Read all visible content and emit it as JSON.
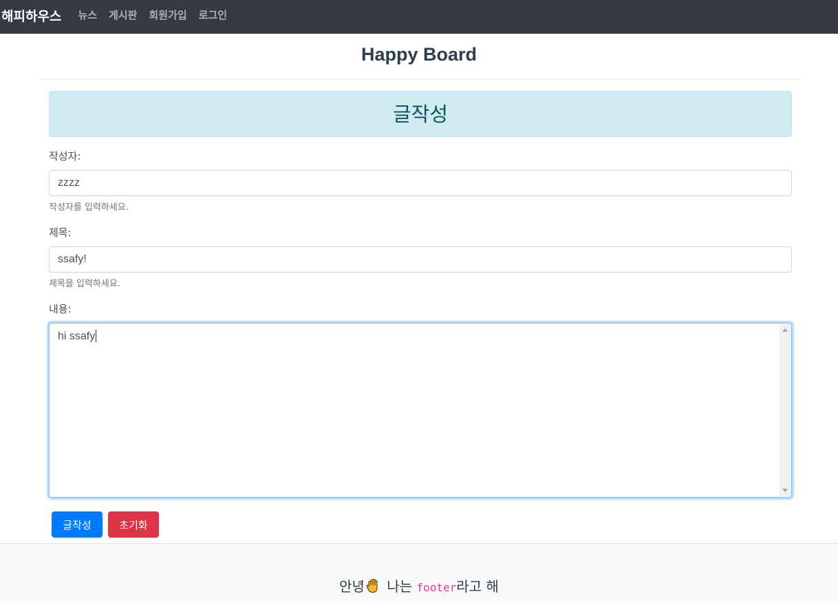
{
  "navbar": {
    "brand": "해피하우스",
    "links": [
      "뉴스",
      "게시판",
      "회원가입",
      "로그인"
    ]
  },
  "header": {
    "title": "Happy Board"
  },
  "form": {
    "heading": "글작성",
    "writer": {
      "label": "작성자:",
      "value": "zzzz",
      "help": "작성자를 입력하세요."
    },
    "subject": {
      "label": "제목:",
      "value": "ssafy!",
      "help": "제목을 입력하세요."
    },
    "content": {
      "label": "내용:",
      "value": "hi ssafy"
    },
    "buttons": {
      "submit": "글작성",
      "reset": "초기화"
    }
  },
  "footer": {
    "text_before": "안녕",
    "icon": "waving-hand-icon",
    "text_middle": " 나는 ",
    "code": "footer",
    "text_after": "라고 해"
  },
  "colors": {
    "navbar_bg": "#343a40",
    "alert_bg": "#d1ecf1",
    "primary": "#007bff",
    "danger": "#dc3545",
    "footer_bg": "#f8f9fa"
  }
}
